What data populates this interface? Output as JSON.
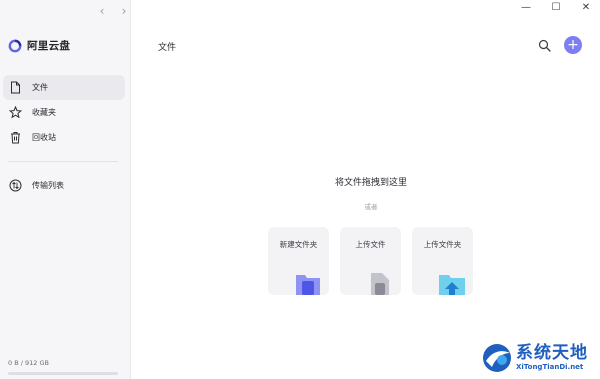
{
  "window": {
    "back_glyph": "‹",
    "forward_glyph": "›",
    "minimize_glyph": "—",
    "maximize_glyph": "☐",
    "close_glyph": "✕"
  },
  "app": {
    "name": "阿里云盘"
  },
  "sidebar": {
    "items": [
      {
        "label": "文件",
        "icon": "file-icon",
        "active": true
      },
      {
        "label": "收藏夹",
        "icon": "star-icon",
        "active": false
      },
      {
        "label": "回收站",
        "icon": "trash-icon",
        "active": false
      },
      {
        "label": "传输列表",
        "icon": "transfer-icon",
        "active": false
      }
    ],
    "storage_text": "0 B / 912 GB",
    "storage_fraction": 0
  },
  "header": {
    "title": "文件",
    "add_glyph": "+"
  },
  "dropzone": {
    "title": "将文件拖拽到这里",
    "or_text": "或者",
    "cards": [
      {
        "label": "新建文件夹",
        "icon": "new-folder-icon"
      },
      {
        "label": "上传文件",
        "icon": "upload-file-icon"
      },
      {
        "label": "上传文件夹",
        "icon": "upload-folder-icon"
      }
    ]
  },
  "watermark": {
    "cn": "系统天地",
    "en": "XiTongTianDi.net"
  },
  "colors": {
    "accent": "#7c7ff2",
    "sidebar_bg": "#f6f6f8",
    "active_item_bg": "#e9e9ee",
    "watermark_blue": "#1f5fbf"
  }
}
